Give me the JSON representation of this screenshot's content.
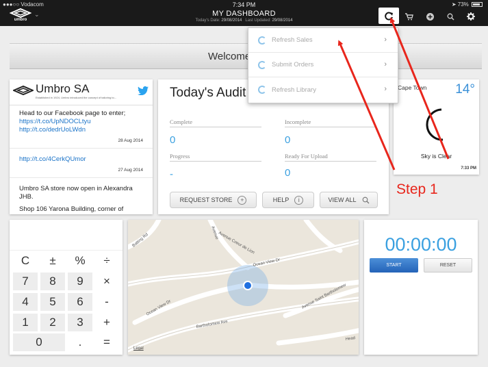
{
  "status_bar": {
    "carrier": "●●●○○ Vodacom",
    "time": "7:34 PM",
    "battery": "73%"
  },
  "nav": {
    "logo_text": "umbro",
    "title": "MY DASHBOARD",
    "todays_date_label": "Today's Date:",
    "todays_date": "29/08/2014",
    "last_updated_label": "Last Updated:",
    "last_updated": "29/08/2014",
    "icons": [
      "refresh-icon",
      "cart-icon",
      "add-icon",
      "search-icon",
      "gear-icon"
    ]
  },
  "banner": {
    "text": "Welcome"
  },
  "dropdown": {
    "items": [
      {
        "label": "Refresh Sales"
      },
      {
        "label": "Submit Orders"
      },
      {
        "label": "Refresh Library"
      }
    ]
  },
  "twitter": {
    "name": "Umbro SA",
    "tagline": "Established in 1924, Umbro introduced the concept of tailoring to...",
    "tweets": [
      {
        "text": "Head to our Facebook page to enter;",
        "link": "https://t.co/UpNDOCLtyu http://t.co/dedrUoLWdn",
        "date": "28 Aug 2014"
      },
      {
        "text": "",
        "link": "http://t.co/4CerkQUmor",
        "date": "27 Aug 2014"
      },
      {
        "text": "Umbro SA store now open in Alexandra JHB.",
        "link": "",
        "date": ""
      },
      {
        "text": "Shop 106 Yarona Building, corner of",
        "link": "",
        "date": ""
      }
    ]
  },
  "audit": {
    "title": "Today's Audit",
    "complete_label": "Complete",
    "complete_value": "0",
    "incomplete_label": "Incomplete",
    "incomplete_value": "0",
    "progress_label": "Progress",
    "progress_value": "-",
    "ready_label": "Ready For Upload",
    "ready_value": "0",
    "request_store": "REQUEST STORE",
    "help": "HELP",
    "view_all": "VIEW ALL"
  },
  "weather": {
    "city": "Cape Town",
    "temp": "14°",
    "description": "Sky is Clear",
    "time": "7:33 PM"
  },
  "calculator": {
    "keys": {
      "clear": "C",
      "plusminus": "±",
      "percent": "%",
      "divide": "÷",
      "seven": "7",
      "eight": "8",
      "nine": "9",
      "multiply": "×",
      "four": "4",
      "five": "5",
      "six": "6",
      "minus": "-",
      "one": "1",
      "two": "2",
      "three": "3",
      "plus": "+",
      "zero": "0",
      "dot": ".",
      "equals": "="
    }
  },
  "map": {
    "roads": [
      "Batting Rd",
      "Avenue Coeur de Lion",
      "Ocean View Dr",
      "Ocean View Dr",
      "Avenue Saint Bartholomew",
      "Bartholomew Ave",
      "Head",
      "Avenue"
    ],
    "legal": "Legal"
  },
  "timer": {
    "value": "00:00:00",
    "start": "START",
    "reset": "RESET"
  },
  "annotation": {
    "step": "Step 1",
    "color": "#e8261c"
  }
}
